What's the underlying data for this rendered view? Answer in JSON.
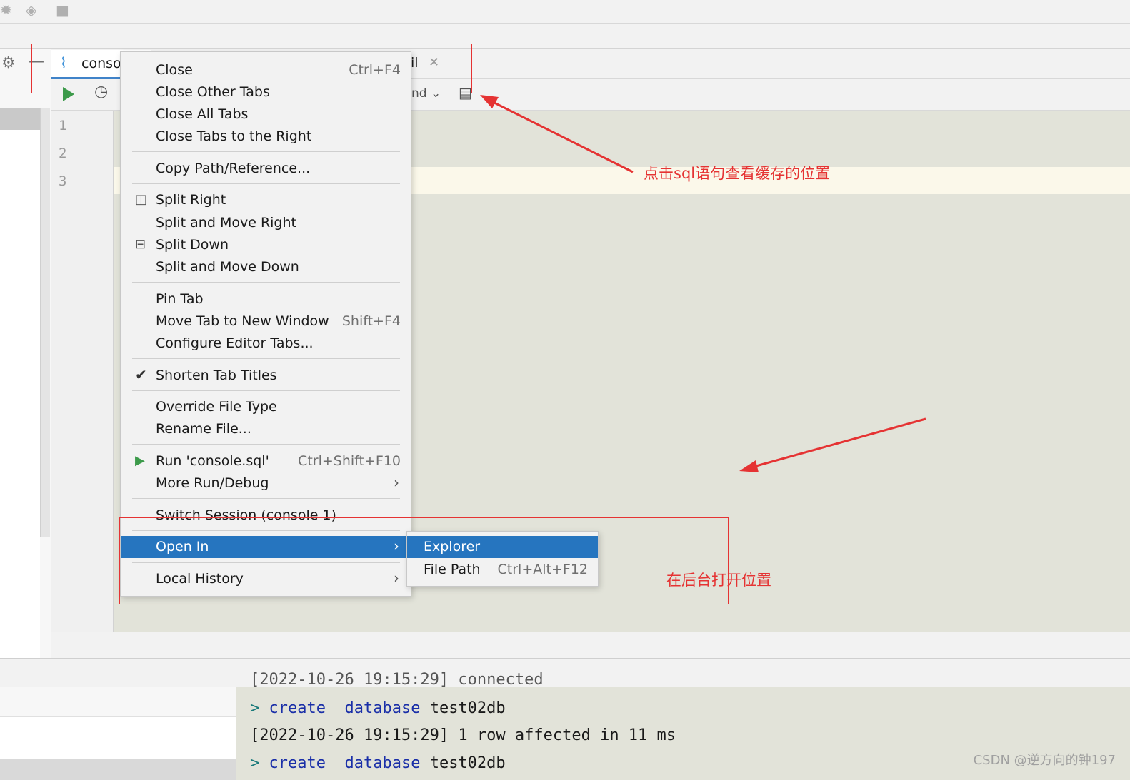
{
  "toolbar": {
    "icons": [
      "bug-icon",
      "coverage-icon",
      "stop-icon"
    ]
  },
  "editor_tab": {
    "label": "consol",
    "partial_label": "il",
    "partial_dropdown": "nd"
  },
  "line_numbers": [
    "1",
    "2",
    "3"
  ],
  "context_menu": {
    "items": [
      {
        "label": "Close",
        "shortcut": "Ctrl+F4"
      },
      {
        "label": "Close Other Tabs"
      },
      {
        "label": "Close All Tabs"
      },
      {
        "label": "Close Tabs to the Right"
      },
      {
        "label": "Copy Path/Reference..."
      },
      {
        "label": "Split Right",
        "icon": "split-vertical-icon"
      },
      {
        "label": "Split and Move Right"
      },
      {
        "label": "Split Down",
        "icon": "split-horizontal-icon"
      },
      {
        "label": "Split and Move Down"
      },
      {
        "label": "Pin Tab"
      },
      {
        "label": "Move Tab to New Window",
        "shortcut": "Shift+F4"
      },
      {
        "label": "Configure Editor Tabs..."
      },
      {
        "label": "Shorten Tab Titles",
        "checked": true
      },
      {
        "label": "Override File Type"
      },
      {
        "label": "Rename File..."
      },
      {
        "label": "Run 'console.sql'",
        "shortcut": "Ctrl+Shift+F10",
        "icon": "run-icon"
      },
      {
        "label": "More Run/Debug",
        "submenu": true
      },
      {
        "label": "Switch Session (console 1)"
      },
      {
        "label": "Open In",
        "submenu": true,
        "selected": true
      },
      {
        "label": "Local History",
        "submenu": true
      }
    ]
  },
  "submenu": {
    "items": [
      {
        "label": "Explorer",
        "selected": true
      },
      {
        "label": "File Path",
        "shortcut": "Ctrl+Alt+F12"
      }
    ]
  },
  "annotations": {
    "note_top": "点击sql语句查看缓存的位置",
    "note_bottom": "在后台打开位置"
  },
  "console": {
    "line0": "[2022-10-26 19:15:29] connected",
    "line1_prompt": ">",
    "line1_kw1": "create",
    "line1_kw2": "database",
    "line1_name": "test02db",
    "line2": "[2022-10-26 19:15:29] 1 row affected in 11 ms",
    "line3_prompt": ">",
    "line3_kw1": "create",
    "line3_kw2": "database",
    "line3_name": "test02db"
  },
  "watermark": "CSDN @逆方向的钟197",
  "colors": {
    "accent": "#2675bf",
    "annotation": "#e53333",
    "editor_bg": "#e2e3d9"
  }
}
